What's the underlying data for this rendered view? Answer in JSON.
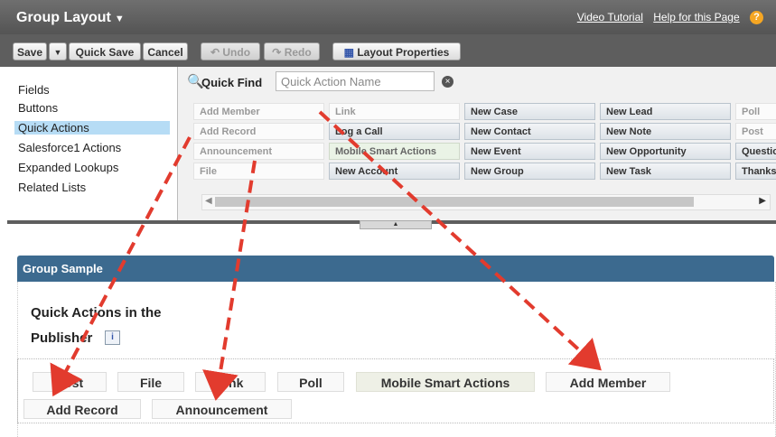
{
  "header": {
    "title": "Group Layout",
    "links": [
      "Video Tutorial",
      "Help for this Page"
    ]
  },
  "toolbar": {
    "save": "Save",
    "save_dropdown": "▼",
    "quick_save": "Quick Save",
    "cancel": "Cancel",
    "undo": "Undo",
    "redo": "Redo",
    "layout_properties": "Layout Properties"
  },
  "leftnav": [
    "Fields",
    "Buttons",
    "Quick Actions",
    "Salesforce1 Actions",
    "Expanded Lookups",
    "Related Lists"
  ],
  "quickfind": {
    "label": "Quick Find",
    "placeholder": "Quick Action Name"
  },
  "palette": {
    "rows": [
      [
        "Add Member",
        "Link",
        "New Case",
        "New Lead",
        "Poll"
      ],
      [
        "Add Record",
        "Log a Call",
        "New Contact",
        "New Note",
        "Post"
      ],
      [
        "Announcement",
        "Mobile Smart Actions",
        "New Event",
        "New Opportunity",
        "Questio"
      ],
      [
        "File",
        "New Account",
        "New Group",
        "New Task",
        "Thanks"
      ]
    ]
  },
  "section": {
    "title": "Group Sample",
    "qa_title_line1": "Quick Actions in the",
    "qa_title_line2": "Publisher",
    "info": "i"
  },
  "publisher": {
    "row1": [
      "Post",
      "File",
      "Link",
      "Poll",
      "Mobile Smart Actions",
      "Add Member"
    ],
    "row2": [
      "Add Record",
      "Announcement"
    ]
  },
  "colors": {
    "arrow": "#e23b2e",
    "section_header": "#3c6a8f",
    "selected_nav": "#b6dcf5"
  }
}
